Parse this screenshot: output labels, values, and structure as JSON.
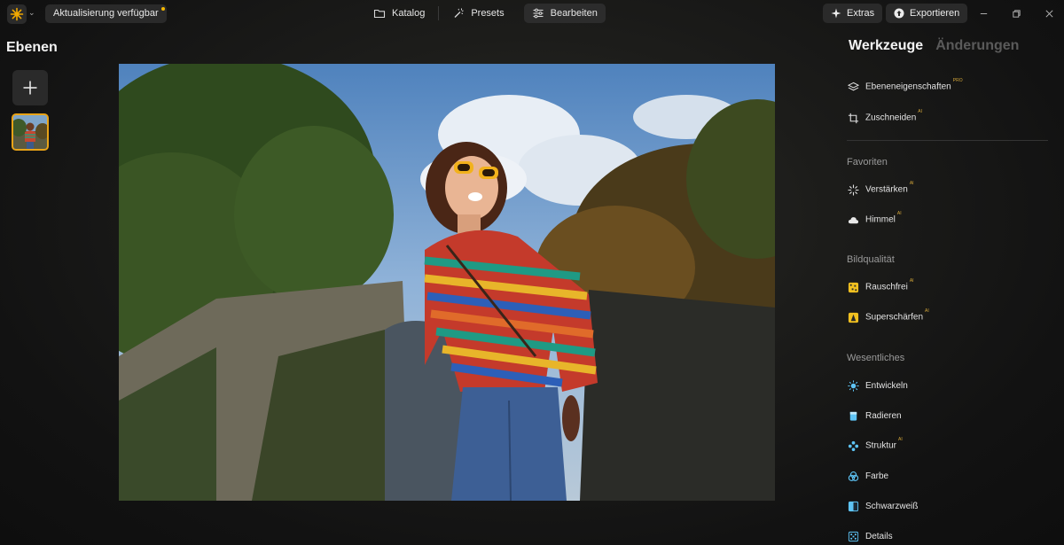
{
  "topbar": {
    "update_label": "Aktualisierung verfügbar",
    "nav": [
      {
        "label": "Katalog",
        "icon": "folder-icon",
        "active": false
      },
      {
        "label": "Presets",
        "icon": "magic-wand-icon",
        "active": false
      },
      {
        "label": "Bearbeiten",
        "icon": "sliders-icon",
        "active": true
      }
    ],
    "extras_label": "Extras",
    "export_label": "Exportieren"
  },
  "left_panel": {
    "title": "Ebenen"
  },
  "right_panel": {
    "tabs": [
      "Werkzeuge",
      "Änderungen"
    ],
    "top_tools": [
      {
        "label": "Ebeneneigenschaften",
        "tag": "PRO",
        "icon": "layers-icon"
      },
      {
        "label": "Zuschneiden",
        "tag": "AI",
        "icon": "crop-icon"
      }
    ],
    "sections": [
      {
        "title": "Favoriten",
        "tools": [
          {
            "label": "Verstärken",
            "tag": "AI",
            "icon": "sparkle-burst-icon"
          },
          {
            "label": "Himmel",
            "tag": "AI",
            "icon": "cloud-icon"
          }
        ]
      },
      {
        "title": "Bildqualität",
        "tools": [
          {
            "label": "Rauschfrei",
            "tag": "AI",
            "icon": "noise-icon"
          },
          {
            "label": "Superschärfen",
            "tag": "AI",
            "icon": "sharpen-icon"
          }
        ]
      },
      {
        "title": "Wesentliches",
        "tools": [
          {
            "label": "Entwickeln",
            "tag": "",
            "icon": "sun-icon"
          },
          {
            "label": "Radieren",
            "tag": "",
            "icon": "eraser-icon"
          },
          {
            "label": "Struktur",
            "tag": "AI",
            "icon": "structure-icon"
          },
          {
            "label": "Farbe",
            "tag": "",
            "icon": "color-rings-icon"
          },
          {
            "label": "Schwarzweiß",
            "tag": "",
            "icon": "black-white-icon"
          },
          {
            "label": "Details",
            "tag": "",
            "icon": "details-grid-icon"
          }
        ]
      }
    ]
  },
  "colors": {
    "accent": "#e8a317",
    "tool_icon": "#8fd0f5",
    "tag": "#d7a93a"
  }
}
